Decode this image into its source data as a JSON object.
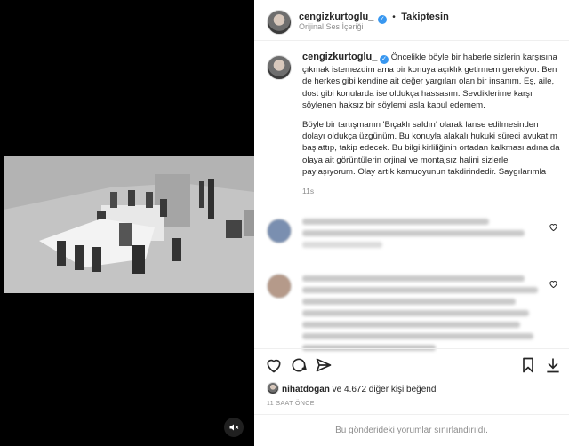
{
  "header": {
    "username": "cengizkurtoglu_",
    "separator": "•",
    "follow_label": "Takiptesin",
    "audio_label": "Orijinal Ses İçeriği"
  },
  "caption": {
    "username": "cengizkurtoglu_",
    "paragraph1": "Öncelikle böyle bir haberle sizlerin karşısına çıkmak istemezdim ama bir konuya açıklık getirmem gerekiyor. Ben de herkes gibi kendine ait değer yargıları olan bir insanım. Eş, aile, dost gibi konularda ise oldukça hassasım. Sevdiklerime karşı söylenen haksız bir söylemi asla kabul edemem.",
    "paragraph2": "Böyle bir tartışmanın 'Bıçaklı saldırı' olarak lanse edilmesinden dolayı oldukça üzgünüm. Bu konuyla alakalı hukuki süreci avukatım başlattıp, takip edecek. Bu bilgi kirliliğinin ortadan kalkması adına da olaya ait görüntülerin orjinal ve montajsız halini sizlerle paylaşıyorum. Olay artık kamuoyunun takdirindedir. Saygılarımla",
    "time": "11s"
  },
  "likes": {
    "liker": "nihatdogan",
    "rest": " ve 4.672 diğer kişi beğendi"
  },
  "post_time": "11 SAAT ÖNCE",
  "restricted_text": "Bu gönderideki yorumlar sınırlandırıldı.",
  "icons": {
    "like": "heart-icon",
    "comment": "comment-icon",
    "share": "send-icon",
    "save": "bookmark-icon",
    "download": "download-icon",
    "more": "more-icon",
    "mute": "speaker-muted-icon"
  }
}
